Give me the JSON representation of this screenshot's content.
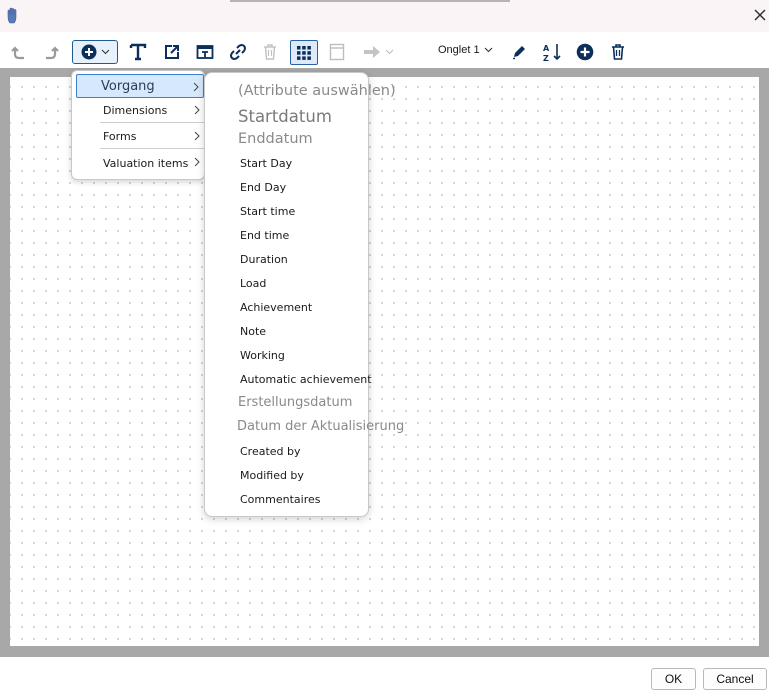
{
  "titlebar": {
    "title": ""
  },
  "toolbar": {
    "tab_label": "Onglet 1"
  },
  "menu_primary": {
    "items": [
      {
        "label": "Vorgang"
      },
      {
        "label": "Dimensions"
      },
      {
        "label": "Forms"
      },
      {
        "label": "Valuation items"
      }
    ]
  },
  "menu_secondary": {
    "items": [
      {
        "label": "(Attribute auswählen)"
      },
      {
        "label": "Startdatum"
      },
      {
        "label": "Enddatum"
      },
      {
        "label": "Start Day"
      },
      {
        "label": "End Day"
      },
      {
        "label": "Start time"
      },
      {
        "label": "End time"
      },
      {
        "label": "Duration"
      },
      {
        "label": "Load"
      },
      {
        "label": "Achievement"
      },
      {
        "label": "Note"
      },
      {
        "label": "Working"
      },
      {
        "label": "Automatic achievement"
      },
      {
        "label": "Erstellungsdatum"
      },
      {
        "label": "Datum der Aktualisierung"
      },
      {
        "label": "Created by"
      },
      {
        "label": "Modified by"
      },
      {
        "label": "Commentaires"
      }
    ]
  },
  "footer": {
    "ok_label": "OK",
    "cancel_label": "Cancel"
  },
  "colors": {
    "accent": "#1f5a95",
    "menu_highlight": "#d6e8fb",
    "canvas_frame": "#a8a8a8"
  }
}
